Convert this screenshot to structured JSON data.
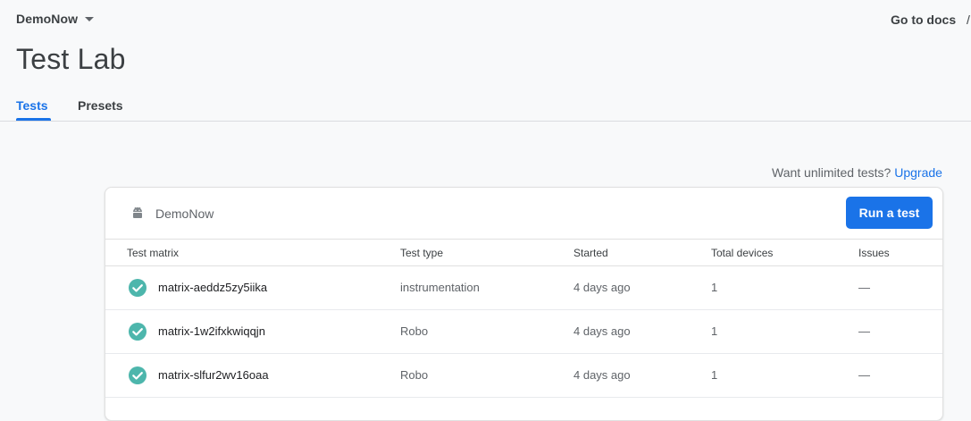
{
  "header": {
    "project": "DemoNow",
    "docs_link": "Go to docs"
  },
  "page": {
    "title": "Test Lab",
    "tabs": [
      {
        "label": "Tests",
        "active": true
      },
      {
        "label": "Presets",
        "active": false
      }
    ]
  },
  "upgrade": {
    "text": "Want unlimited tests?",
    "link": "Upgrade"
  },
  "card": {
    "app_name": "DemoNow",
    "app_icon": "android-icon",
    "run_button": "Run a test",
    "columns": [
      "Test matrix",
      "Test type",
      "Started",
      "Total devices",
      "Issues"
    ],
    "rows": [
      {
        "status": "passed",
        "matrix": "matrix-aeddz5zy5iika",
        "type": "instrumentation",
        "started": "4 days ago",
        "devices": "1",
        "issues": "—"
      },
      {
        "status": "passed",
        "matrix": "matrix-1w2ifxkwiqqjn",
        "type": "Robo",
        "started": "4 days ago",
        "devices": "1",
        "issues": "—"
      },
      {
        "status": "passed",
        "matrix": "matrix-slfur2wv16oaa",
        "type": "Robo",
        "started": "4 days ago",
        "devices": "1",
        "issues": "—"
      }
    ]
  },
  "colors": {
    "accent": "#1a73e8",
    "success": "#4db6ac"
  }
}
